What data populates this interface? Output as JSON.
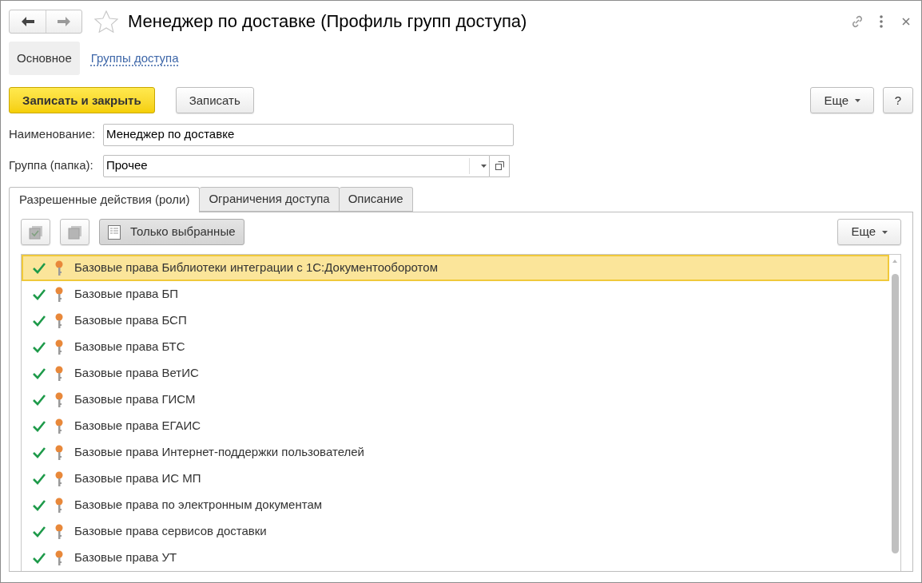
{
  "window": {
    "title": "Менеджер по доставке (Профиль групп доступа)",
    "favorite": false
  },
  "sections": [
    {
      "label": "Основное",
      "selected": true
    },
    {
      "label": "Группы доступа",
      "selected": false
    }
  ],
  "toolbar": {
    "primary": "Записать и закрыть",
    "secondary": "Записать",
    "more": "Еще",
    "help": "?"
  },
  "fields": [
    {
      "label": "Наименование:",
      "value": "Менеджер по доставке",
      "kind": "text"
    },
    {
      "label": "Группа (папка):",
      "value": "Прочее",
      "kind": "select"
    }
  ],
  "tabs": [
    {
      "label": "Разрешенные действия (роли)",
      "selected": true
    },
    {
      "label": "Ограничения доступа",
      "selected": false
    },
    {
      "label": "Описание",
      "selected": false
    }
  ],
  "roles_toolbar": {
    "filter": "Только выбранные",
    "more": "Еще"
  },
  "roles": [
    {
      "name": "Базовые права Библиотеки интеграции с 1С:Документооборотом",
      "checked": true,
      "selected": true
    },
    {
      "name": "Базовые права БП",
      "checked": true,
      "selected": false
    },
    {
      "name": "Базовые права БСП",
      "checked": true,
      "selected": false
    },
    {
      "name": "Базовые права БТС",
      "checked": true,
      "selected": false
    },
    {
      "name": "Базовые права ВетИС",
      "checked": true,
      "selected": false
    },
    {
      "name": "Базовые права ГИСМ",
      "checked": true,
      "selected": false
    },
    {
      "name": "Базовые права ЕГАИС",
      "checked": true,
      "selected": false
    },
    {
      "name": "Базовые права Интернет-поддержки пользователей",
      "checked": true,
      "selected": false
    },
    {
      "name": "Базовые права ИС МП",
      "checked": true,
      "selected": false
    },
    {
      "name": "Базовые права по электронным документам",
      "checked": true,
      "selected": false
    },
    {
      "name": "Базовые права сервисов доставки",
      "checked": true,
      "selected": false
    },
    {
      "name": "Базовые права УТ",
      "checked": true,
      "selected": false
    }
  ]
}
